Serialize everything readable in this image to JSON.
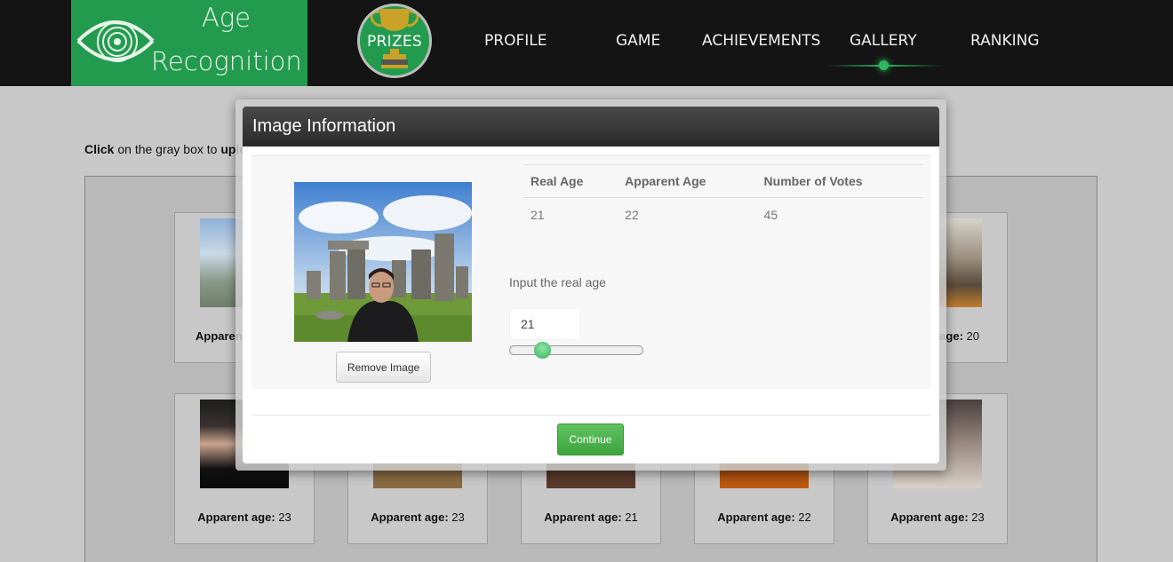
{
  "header": {
    "logo_line1": "Age",
    "logo_line2": "Recognition",
    "prizes_label": "PRIZES",
    "nav": [
      {
        "label": "PROFILE"
      },
      {
        "label": "GAME"
      },
      {
        "label": "ACHIEVEMENTS"
      },
      {
        "label": "GALLERY",
        "active": true
      },
      {
        "label": "RANKING"
      }
    ],
    "accent_color": "#239b4f"
  },
  "page": {
    "instruction_bold": "Click",
    "instruction_text": " on the gray box to ",
    "instruction_bold2": "uplo",
    "gallery": {
      "caption_label": "Apparent age:",
      "row1": [
        {
          "caption": "Apparen",
          "age": ""
        },
        {
          "caption": "t age:",
          "age": "20"
        }
      ],
      "row2": [
        {
          "age": "23"
        },
        {
          "age": "23"
        },
        {
          "age": "21"
        },
        {
          "age": "22"
        },
        {
          "age": "23"
        }
      ]
    }
  },
  "modal": {
    "title": "Image Information",
    "table": {
      "headers": [
        "Real Age",
        "Apparent Age",
        "Number of Votes"
      ],
      "row": [
        "21",
        "22",
        "45"
      ]
    },
    "input_label": "Input the real age",
    "input_value": "21",
    "slider_value": 21,
    "remove_button": "Remove Image",
    "continue_button": "Continue",
    "continue_color": "#4cae4c"
  }
}
